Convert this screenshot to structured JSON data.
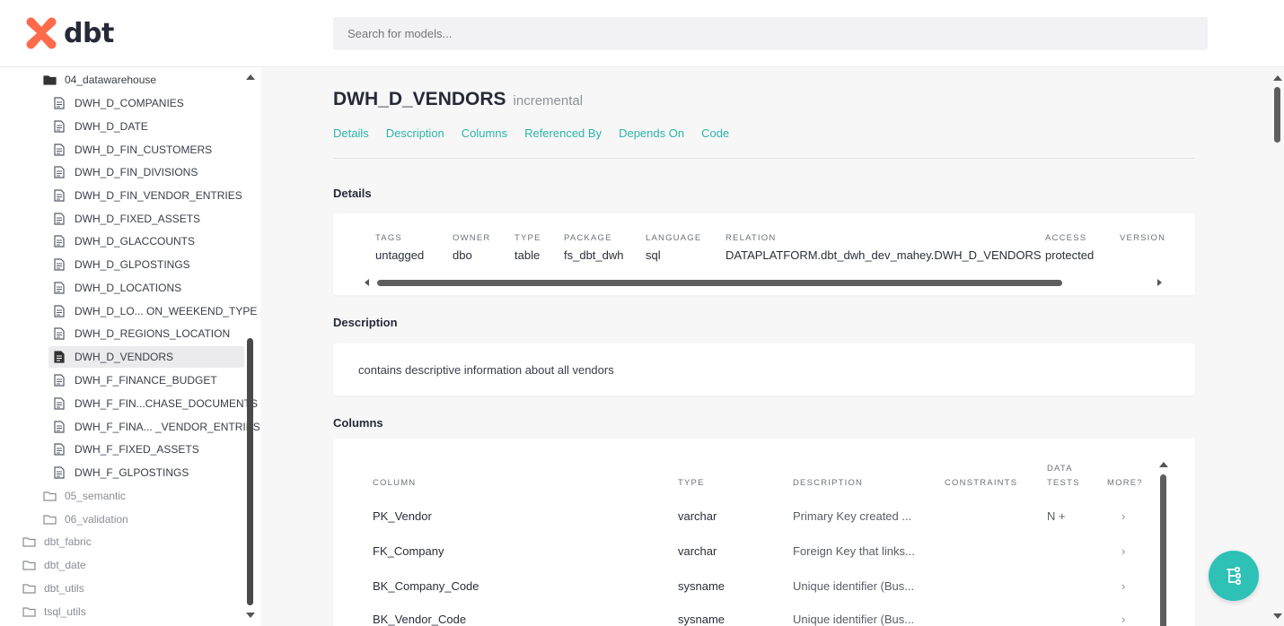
{
  "header": {
    "logo_text": "dbt",
    "search_placeholder": "Search for models..."
  },
  "sidebar": {
    "items": [
      {
        "label": "04_datawarehouse",
        "type": "folder-open"
      },
      {
        "label": "DWH_D_COMPANIES",
        "type": "file"
      },
      {
        "label": "DWH_D_DATE",
        "type": "file"
      },
      {
        "label": "DWH_D_FIN_CUSTOMERS",
        "type": "file"
      },
      {
        "label": "DWH_D_FIN_DIVISIONS",
        "type": "file"
      },
      {
        "label": "DWH_D_FIN_VENDOR_ENTRIES",
        "type": "file"
      },
      {
        "label": "DWH_D_FIXED_ASSETS",
        "type": "file"
      },
      {
        "label": "DWH_D_GLACCOUNTS",
        "type": "file"
      },
      {
        "label": "DWH_D_GLPOSTINGS",
        "type": "file"
      },
      {
        "label": "DWH_D_LOCATIONS",
        "type": "file"
      },
      {
        "label": "DWH_D_LO... ON_WEEKEND_TYPE",
        "type": "file"
      },
      {
        "label": "DWH_D_REGIONS_LOCATION",
        "type": "file"
      },
      {
        "label": "DWH_D_VENDORS",
        "type": "file",
        "selected": true
      },
      {
        "label": "DWH_F_FINANCE_BUDGET",
        "type": "file"
      },
      {
        "label": "DWH_F_FIN...CHASE_DOCUMENTS",
        "type": "file"
      },
      {
        "label": "DWH_F_FINA... _VENDOR_ENTRIES",
        "type": "file"
      },
      {
        "label": "DWH_F_FIXED_ASSETS",
        "type": "file"
      },
      {
        "label": "DWH_F_GLPOSTINGS",
        "type": "file"
      },
      {
        "label": "05_semantic",
        "type": "folder"
      },
      {
        "label": "06_validation",
        "type": "folder"
      },
      {
        "label": "dbt_fabric",
        "type": "folder"
      },
      {
        "label": "dbt_date",
        "type": "folder"
      },
      {
        "label": "dbt_utils",
        "type": "folder"
      },
      {
        "label": "tsql_utils",
        "type": "folder"
      }
    ]
  },
  "model": {
    "name": "DWH_D_VENDORS",
    "materialization": "incremental",
    "tabs": [
      "Details",
      "Description",
      "Columns",
      "Referenced By",
      "Depends On",
      "Code"
    ]
  },
  "details": {
    "heading": "Details",
    "fields": [
      {
        "key": "TAGS",
        "value": "untagged"
      },
      {
        "key": "OWNER",
        "value": "dbo"
      },
      {
        "key": "TYPE",
        "value": "table"
      },
      {
        "key": "PACKAGE",
        "value": "fs_dbt_dwh"
      },
      {
        "key": "LANGUAGE",
        "value": "sql"
      },
      {
        "key": "RELATION",
        "value": "DATAPLATFORM.dbt_dwh_dev_mahey.DWH_D_VENDORS"
      },
      {
        "key": "ACCESS",
        "value": "protected"
      },
      {
        "key": "VERSION",
        "value": ""
      }
    ]
  },
  "description": {
    "heading": "Description",
    "text": "contains descriptive information about all vendors"
  },
  "columns": {
    "heading": "Columns",
    "headers": {
      "column": "COLUMN",
      "type": "TYPE",
      "description": "DESCRIPTION",
      "constraints": "CONSTRAINTS",
      "data_tests_1": "DATA",
      "data_tests_2": "TESTS",
      "more": "MORE?"
    },
    "rows": [
      {
        "column": "PK_Vendor",
        "type": "varchar",
        "description": "Primary Key created ...",
        "tests": "N +",
        "more": "›"
      },
      {
        "column": "FK_Company",
        "type": "varchar",
        "description": "Foreign Key that links...",
        "tests": "",
        "more": "›"
      },
      {
        "column": "BK_Company_Code",
        "type": "sysname",
        "description": "Unique identifier (Bus...",
        "tests": "",
        "more": "›"
      },
      {
        "column": "BK_Vendor_Code",
        "type": "sysname",
        "description": "Unique identifier (Bus...",
        "tests": "",
        "more": "›"
      }
    ]
  },
  "colors": {
    "accent": "#2bb5a8",
    "logo_orange": "#fe6b4a",
    "fab": "#2ec1b6"
  }
}
